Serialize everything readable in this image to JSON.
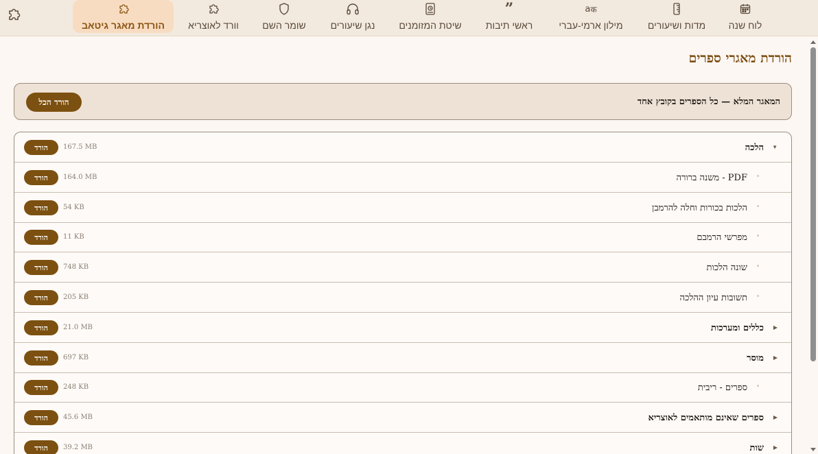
{
  "nav": {
    "tabs": [
      {
        "label": "לוח שנה",
        "icon": "calendar-icon"
      },
      {
        "label": "מדות ושיעורים",
        "icon": "ruler-icon"
      },
      {
        "label": "מילון ארמי-עברי",
        "icon": "translate-icon"
      },
      {
        "label": "ראשי תיבות",
        "icon": "quote-icon"
      },
      {
        "label": "שיטת המזומנים",
        "icon": "book-icon"
      },
      {
        "label": "נגן שיעורים",
        "icon": "headphones-icon"
      },
      {
        "label": "שומר השם",
        "icon": "shield-icon"
      },
      {
        "label": "וורד לאוצריא",
        "icon": "puzzle-icon"
      },
      {
        "label": "הורדת מאגר גיטאב",
        "icon": "puzzle-icon",
        "active": true
      }
    ],
    "settings_icon": "puzzle-settings-icon"
  },
  "page": {
    "title": "הורדת מאגרי ספרים"
  },
  "full_repo": {
    "text": "המאגר המלא — כל הספרים בקובץ אחד",
    "button_label": "הורד הכל"
  },
  "download_label": "הורד",
  "rows": [
    {
      "type": "cat",
      "name": "הלכה",
      "size": "167.5 MB",
      "expanded": true
    },
    {
      "type": "sub",
      "name": "PDF - משנה ברורה",
      "size": "164.0 MB"
    },
    {
      "type": "sub",
      "name": "הלכות בכורות וחלה להרמבן",
      "size": "54 KB"
    },
    {
      "type": "sub",
      "name": "מפרשי הרמבם",
      "size": "11 KB"
    },
    {
      "type": "sub",
      "name": "שונה הלכות",
      "size": "748 KB"
    },
    {
      "type": "sub",
      "name": "תשובות עיון ההלכה",
      "size": "205 KB"
    },
    {
      "type": "cat",
      "name": "כללים ומערכות",
      "size": "21.0 MB",
      "expanded": false
    },
    {
      "type": "cat",
      "name": "מוסר",
      "size": "697 KB",
      "expanded": false
    },
    {
      "type": "sub",
      "name": "ספרים - ריבית",
      "size": "248 KB"
    },
    {
      "type": "cat",
      "name": "ספרים שאינם מותאמים לאוצריא",
      "size": "45.6 MB",
      "expanded": false
    },
    {
      "type": "cat",
      "name": "שות",
      "size": "39.2 MB",
      "expanded": false
    }
  ],
  "colors": {
    "accent": "#7c5010",
    "title": "#7a4e12",
    "active_tab_bg": "#f8dcc1",
    "topbar_bg": "#f3eadf",
    "page_bg": "#fdf7f3"
  }
}
